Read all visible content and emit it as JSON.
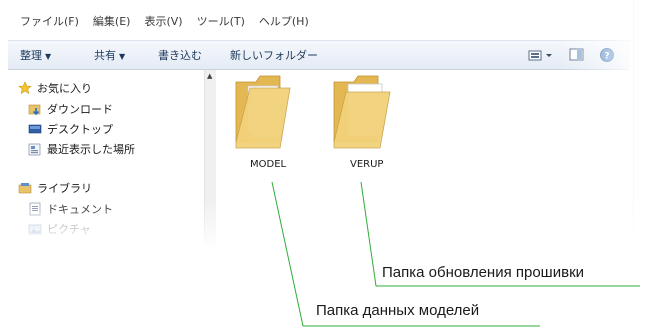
{
  "menu": {
    "file": "ファイル(F)",
    "edit": "編集(E)",
    "view": "表示(V)",
    "tools": "ツール(T)",
    "help": "ヘルプ(H)"
  },
  "toolbar": {
    "organize": "整理",
    "share": "共有",
    "burn": "書き込む",
    "new_folder": "新しいフォルダー",
    "right_icons": [
      "view-options-icon",
      "preview-pane-icon",
      "help-icon"
    ]
  },
  "nav": {
    "favorites": "お気に入り",
    "downloads": "ダウンロード",
    "desktop": "デスクトップ",
    "recent": "最近表示した場所",
    "libraries": "ライブラリ",
    "documents": "ドキュメント",
    "pictures": "ピクチャ"
  },
  "folders": [
    {
      "name": "MODEL"
    },
    {
      "name": "VERUP"
    }
  ],
  "callouts": {
    "verup": "Папка обновления прошивки",
    "model": "Папка данных моделей"
  },
  "colors": {
    "callout_line": "#2fae3a",
    "toolbar_text": "#1e395b",
    "folder": "#f2d27a"
  }
}
